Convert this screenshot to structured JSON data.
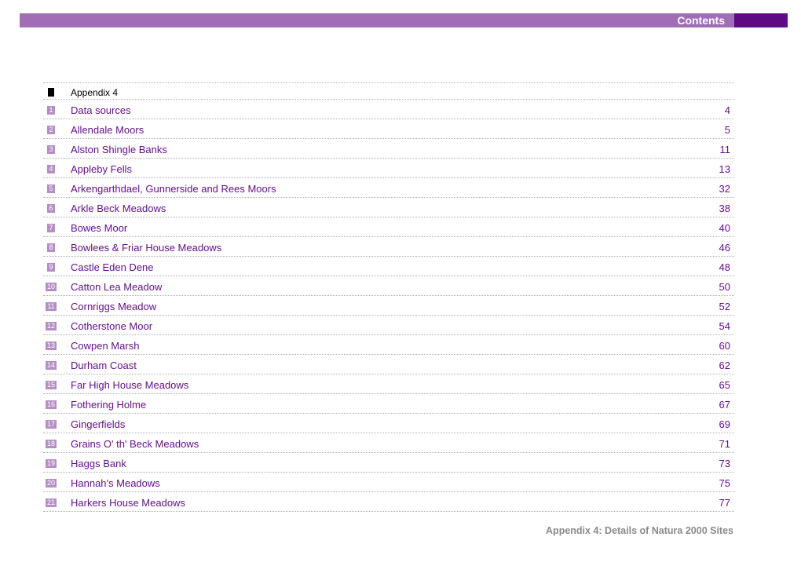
{
  "header": {
    "title": "Contents",
    "accent": "#a16db7",
    "accent_dark": "#5f0a84"
  },
  "toc": {
    "heading": "Appendix 4",
    "entries": [
      {
        "num": "1",
        "title": "Data sources",
        "page": "4"
      },
      {
        "num": "2",
        "title": "Allendale Moors",
        "page": "5"
      },
      {
        "num": "3",
        "title": "Alston Shingle Banks",
        "page": "11"
      },
      {
        "num": "4",
        "title": "Appleby Fells",
        "page": "13"
      },
      {
        "num": "5",
        "title": "Arkengarthdael, Gunnerside and Rees Moors",
        "page": "32"
      },
      {
        "num": "6",
        "title": "Arkle Beck Meadows",
        "page": "38"
      },
      {
        "num": "7",
        "title": "Bowes Moor",
        "page": "40"
      },
      {
        "num": "8",
        "title": "Bowlees & Friar House Meadows",
        "page": "46"
      },
      {
        "num": "9",
        "title": "Castle Eden Dene",
        "page": "48"
      },
      {
        "num": "10",
        "title": "Catton Lea Meadow",
        "page": "50"
      },
      {
        "num": "11",
        "title": "Cornriggs Meadow",
        "page": "52"
      },
      {
        "num": "12",
        "title": "Cotherstone Moor",
        "page": "54"
      },
      {
        "num": "13",
        "title": "Cowpen Marsh",
        "page": "60"
      },
      {
        "num": "14",
        "title": "Durham Coast",
        "page": "62"
      },
      {
        "num": "15",
        "title": "Far High House Meadows",
        "page": "65"
      },
      {
        "num": "16",
        "title": "Fothering Holme",
        "page": "67"
      },
      {
        "num": "17",
        "title": "Gingerfields",
        "page": "69"
      },
      {
        "num": "18",
        "title": "Grains O' th' Beck Meadows",
        "page": "71"
      },
      {
        "num": "19",
        "title": "Haggs Bank",
        "page": "73"
      },
      {
        "num": "20",
        "title": "Hannah's Meadows",
        "page": "75"
      },
      {
        "num": "21",
        "title": "Harkers House Meadows",
        "page": "77"
      }
    ]
  },
  "footer": {
    "text": "Appendix 4: Details of Natura 2000 Sites"
  }
}
